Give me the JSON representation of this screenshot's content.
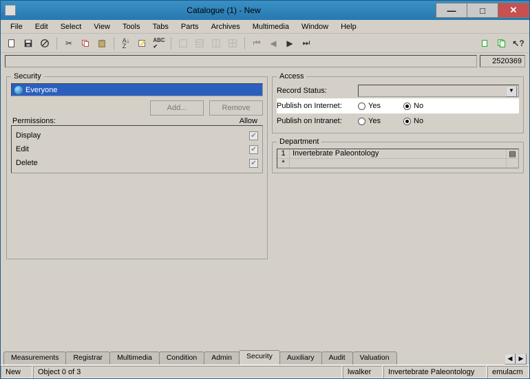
{
  "window": {
    "title": "Catalogue (1) - New",
    "record_number": "2520369"
  },
  "menu": [
    "File",
    "Edit",
    "Select",
    "View",
    "Tools",
    "Tabs",
    "Parts",
    "Archives",
    "Multimedia",
    "Window",
    "Help"
  ],
  "security": {
    "legend": "Security",
    "items": [
      "Everyone"
    ],
    "buttons": {
      "add": "Add...",
      "remove": "Remove"
    },
    "perm_header_left": "Permissions:",
    "perm_header_right": "Allow",
    "permissions": [
      {
        "label": "Display",
        "checked": true
      },
      {
        "label": "Edit",
        "checked": true
      },
      {
        "label": "Delete",
        "checked": true
      }
    ]
  },
  "access": {
    "legend": "Access",
    "record_status_label": "Record Status:",
    "record_status_value": "",
    "rows": [
      {
        "label": "Publish on Internet:",
        "yes": "Yes",
        "no": "No",
        "selected": "no",
        "highlight": true
      },
      {
        "label": "Publish on Intranet:",
        "yes": "Yes",
        "no": "No",
        "selected": "no",
        "highlight": false
      }
    ]
  },
  "department": {
    "legend": "Department",
    "rows": [
      {
        "idx": "1",
        "value": "Invertebrate Paleontology"
      },
      {
        "idx": "*",
        "value": ""
      }
    ]
  },
  "tabs": [
    "Measurements",
    "Registrar",
    "Multimedia",
    "Condition",
    "Admin",
    "Security",
    "Auxiliary",
    "Audit",
    "Valuation"
  ],
  "active_tab": "Security",
  "status": {
    "left": "New",
    "object": "Object 0 of 3",
    "user": "lwalker",
    "dept": "Invertebrate Paleontology",
    "srv": "emulacm"
  }
}
